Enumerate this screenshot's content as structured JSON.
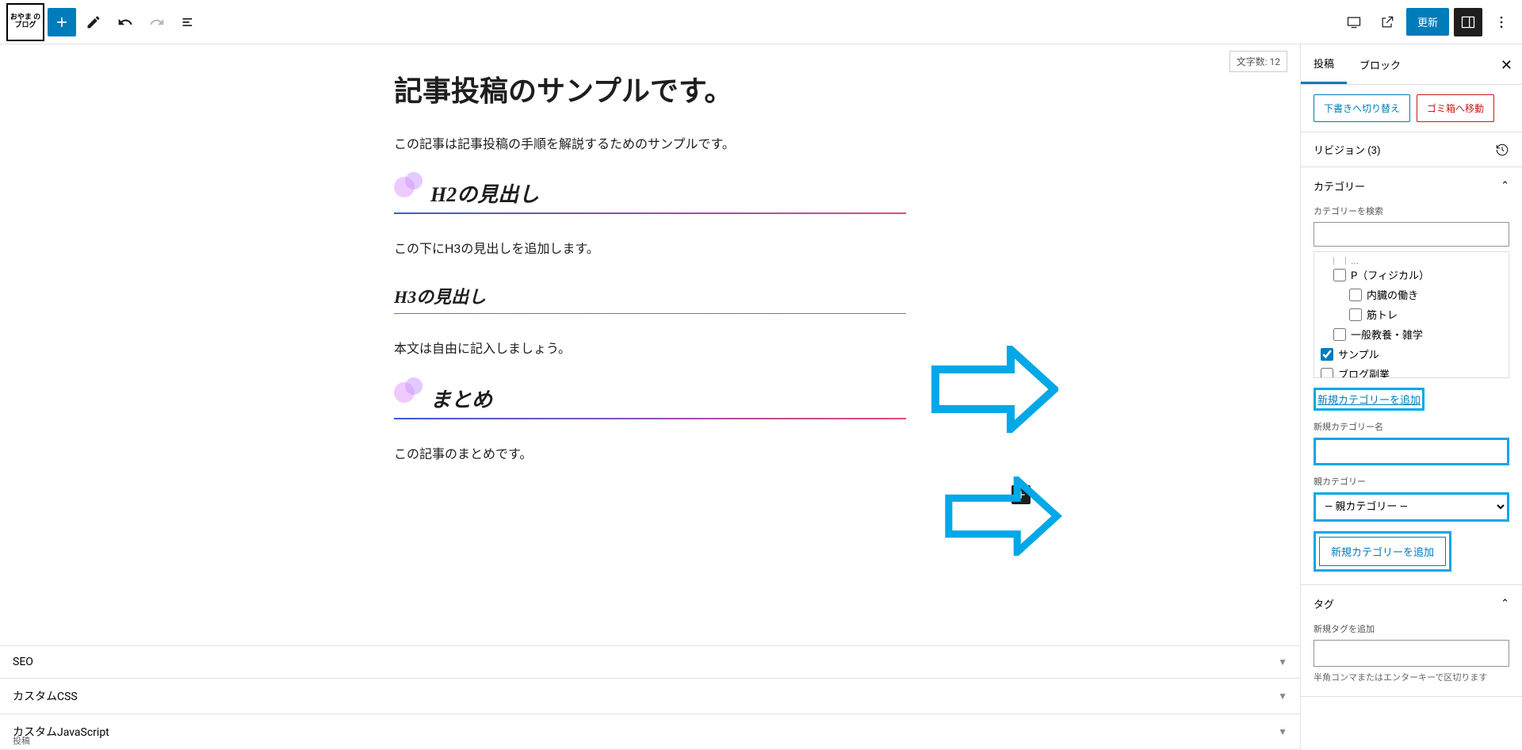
{
  "site_logo": "おやま\nの\nブログ",
  "toolbar": {
    "update_label": "更新"
  },
  "editor": {
    "word_count_label": "文字数:",
    "word_count_value": "12",
    "title": "記事投稿のサンプルです。",
    "para1": "この記事は記事投稿の手順を解説するためのサンプルです。",
    "h2_1": "H2の見出し",
    "para2": "この下にH3の見出しを追加します。",
    "h3_1": "H3の見出し",
    "para3": "本文は自由に記入しましょう。",
    "h2_2": "まとめ",
    "para4": "この記事のまとめです。"
  },
  "meta_panels": {
    "seo": "SEO",
    "custom_css": "カスタムCSS",
    "custom_js": "カスタムJavaScript",
    "footer": "投稿"
  },
  "sidebar": {
    "tabs": {
      "post": "投稿",
      "block": "ブロック"
    },
    "draft_btn": "下書きへ切り替え",
    "trash_btn": "ゴミ箱へ移動",
    "revisions_label": "リビジョン (3)",
    "category": {
      "header": "カテゴリー",
      "search_label": "カテゴリーを検索",
      "items": [
        {
          "label": "P（フィジカル）",
          "checked": false,
          "indent": 1
        },
        {
          "label": "内臓の働き",
          "checked": false,
          "indent": 2
        },
        {
          "label": "筋トレ",
          "checked": false,
          "indent": 2
        },
        {
          "label": "一般教養・雑学",
          "checked": false,
          "indent": 1
        },
        {
          "label": "サンプル",
          "checked": true,
          "indent": 0
        },
        {
          "label": "ブログ副業",
          "checked": false,
          "indent": 0
        }
      ],
      "add_link": "新規カテゴリーを追加",
      "new_name_label": "新規カテゴリー名",
      "parent_label": "親カテゴリー",
      "parent_placeholder": "— 親カテゴリー —",
      "add_btn": "新規カテゴリーを追加"
    },
    "tag": {
      "header": "タグ",
      "add_label": "新規タグを追加",
      "help": "半角コンマまたはエンターキーで区切ります"
    }
  }
}
